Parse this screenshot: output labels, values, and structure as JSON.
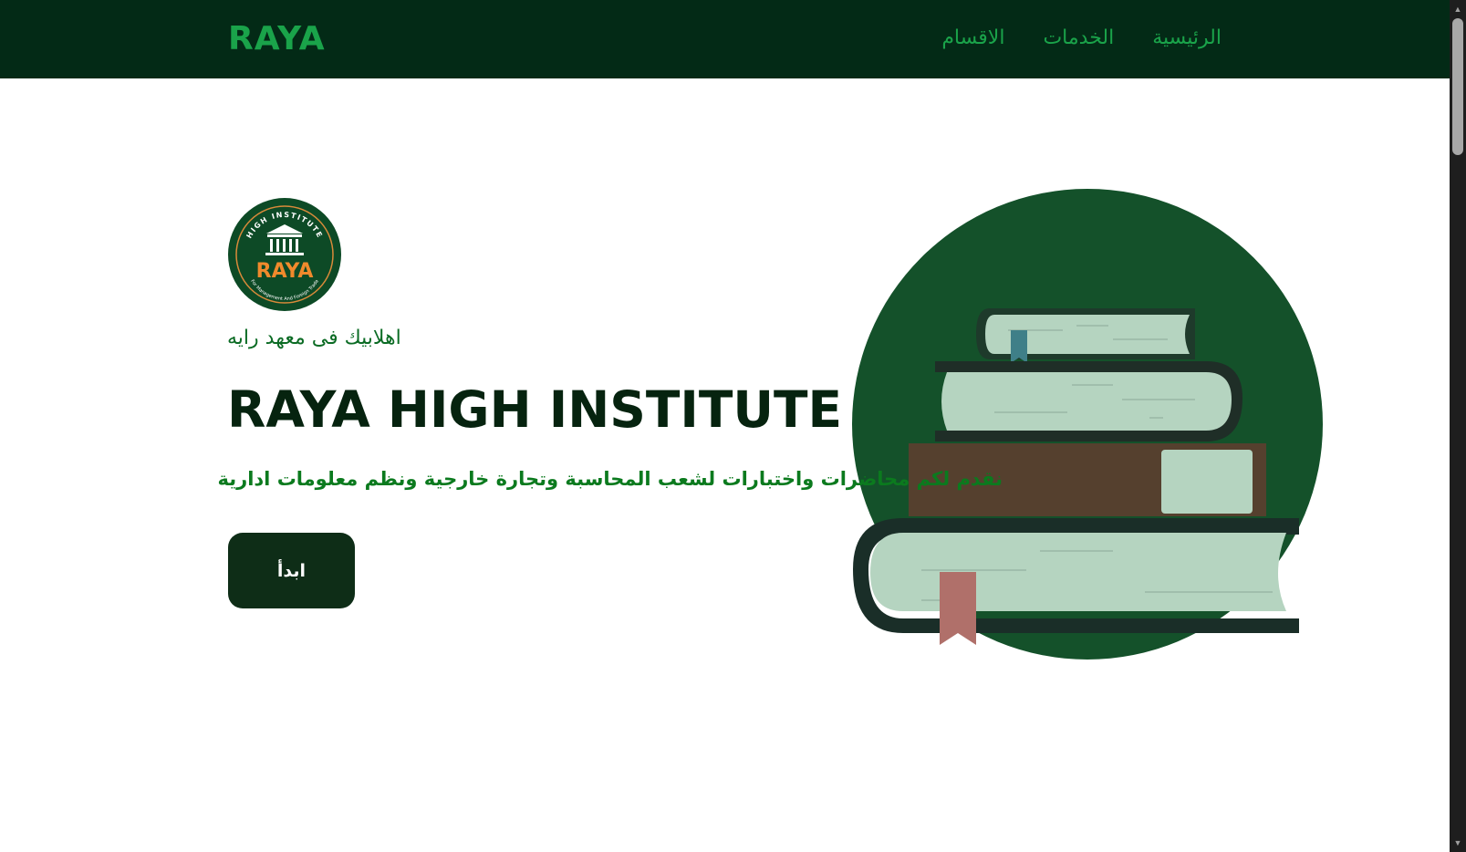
{
  "navbar": {
    "brand": "RAYA",
    "links": [
      {
        "label": "الاقسام"
      },
      {
        "label": "الخدمات"
      },
      {
        "label": "الرئيسية"
      }
    ]
  },
  "hero": {
    "logo": {
      "ring_text": "HIGH INSTITUTE",
      "wordmark": "RAYA",
      "bottom_text": "For Management And Foreign Trade"
    },
    "welcome": "اهلابيك فى معهد رايه",
    "title": "RAYA HIGH INSTITUTE",
    "description": "نقدم لكم محاضرات واختبارات لشعب المحاسبة وتجارة خارجية ونظم معلومات ادارية",
    "start_label": "ابدأ"
  },
  "colors": {
    "navbar_bg": "#032a16",
    "brand_green": "#1aa34a",
    "title_dark": "#06230f",
    "desc_green": "#0b7a1e",
    "button_bg": "#0e2d17",
    "circle_green": "#14512a"
  },
  "icons": {
    "scroll_up": "triangle-up-icon",
    "scroll_down": "triangle-down-icon"
  }
}
